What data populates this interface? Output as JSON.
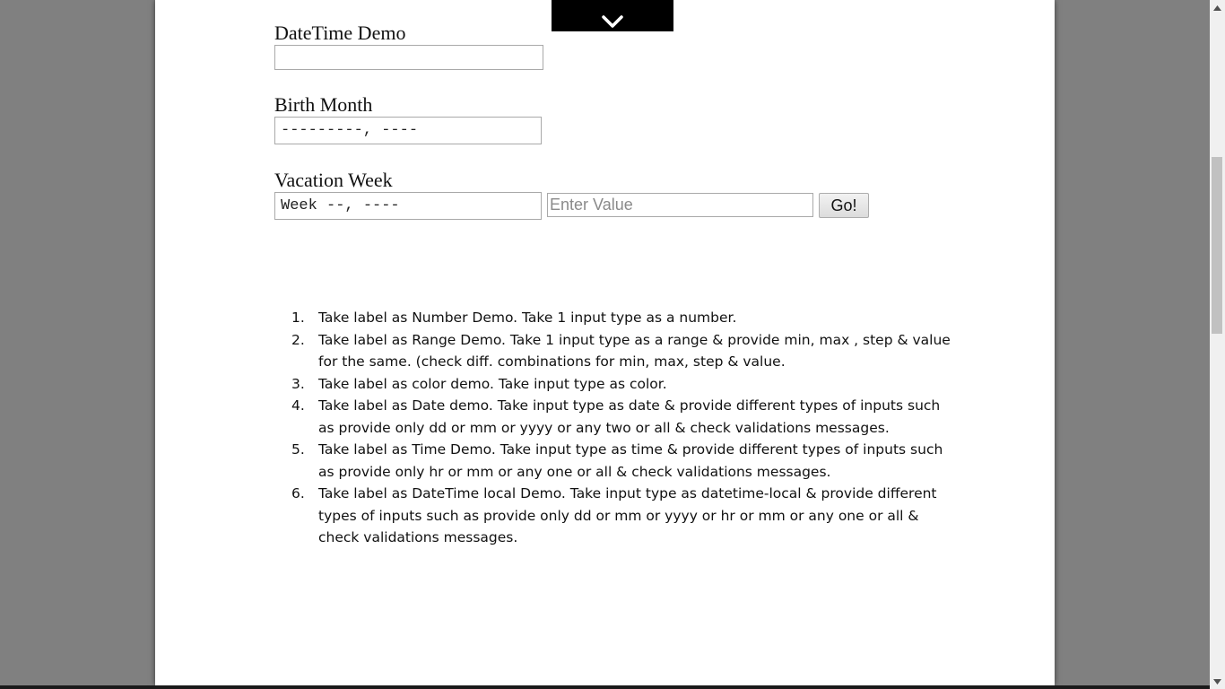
{
  "form": {
    "datetime": {
      "label": "DateTime Demo",
      "value": ""
    },
    "birth_month": {
      "label": "Birth Month",
      "value": "---------, ----"
    },
    "vacation_week": {
      "label": "Vacation Week",
      "value": "Week --, ----"
    },
    "value_input": {
      "placeholder": "Enter Value",
      "value": ""
    },
    "go_button": {
      "label": "Go!"
    }
  },
  "toggle": {
    "icon": "chevron-down-icon"
  },
  "instructions": [
    {
      "num": "1.",
      "text": "Take label as Number Demo. Take 1 input type as a number."
    },
    {
      "num": "2.",
      "text": "Take label as Range Demo. Take 1 input type as a range & provide min, max , step & value for the same. (check diff. combinations for min, max, step & value."
    },
    {
      "num": "3.",
      "text": "Take label as color demo.  Take input type as color."
    },
    {
      "num": "4.",
      "text": "Take label as Date demo.  Take input type as date & provide different types of inputs such as provide only dd or mm or yyyy or any two or all & check validations messages."
    },
    {
      "num": "5.",
      "text": "Take label as Time Demo. Take input type as time & provide different types of inputs such as provide only hr or mm or any one or all & check validations messages."
    },
    {
      "num": "6.",
      "text": "Take label as DateTime local Demo. Take input type as datetime-local & provide different types of inputs such as provide only dd or mm or yyyy or hr or mm or any one or all & check validations messages."
    }
  ],
  "colors": {
    "background": "#808080",
    "page": "#ffffff",
    "toggle": "#000000"
  }
}
